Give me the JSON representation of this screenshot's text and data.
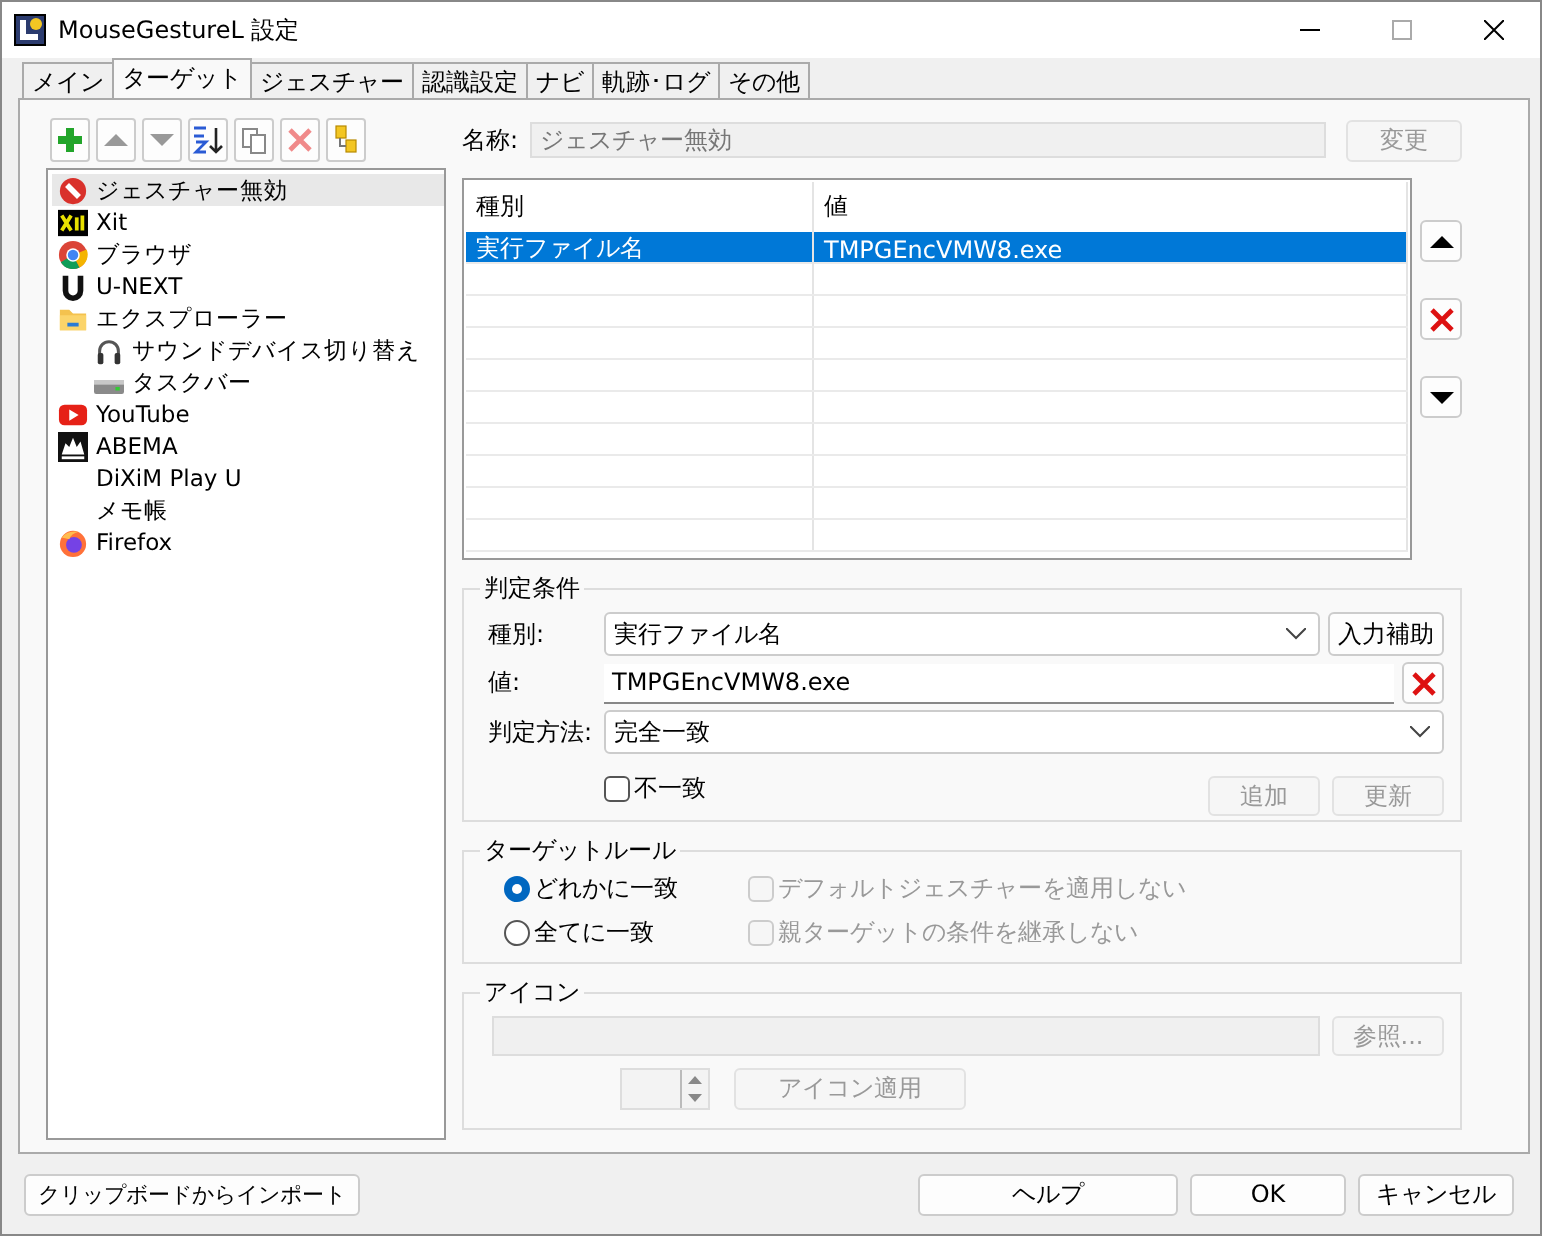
{
  "window": {
    "title": "MouseGestureL 設定"
  },
  "tabs": [
    {
      "label": "メイン",
      "selected": false
    },
    {
      "label": "ターゲット",
      "selected": true
    },
    {
      "label": "ジェスチャー",
      "selected": false
    },
    {
      "label": "認識設定",
      "selected": false
    },
    {
      "label": "ナビ",
      "selected": false
    },
    {
      "label": "軌跡･ログ",
      "selected": false
    },
    {
      "label": "その他",
      "selected": false
    }
  ],
  "targets": [
    {
      "label": "ジェスチャー無効",
      "selected": true
    },
    {
      "label": "Xit",
      "selected": false
    },
    {
      "label": "ブラウザ",
      "selected": false
    },
    {
      "label": "U-NEXT",
      "selected": false
    },
    {
      "label": "エクスプローラー",
      "selected": false,
      "children": [
        {
          "label": "サウンドデバイス切り替え",
          "selected": false
        },
        {
          "label": "タスクバー",
          "selected": false
        }
      ]
    },
    {
      "label": "YouTube",
      "selected": false
    },
    {
      "label": "ABEMA",
      "selected": false
    },
    {
      "label": "DiXiM Play U",
      "selected": false
    },
    {
      "label": "メモ帳",
      "selected": false
    },
    {
      "label": "Firefox",
      "selected": false
    }
  ],
  "name_field": {
    "label": "名称:",
    "value": "ジェスチャー無効",
    "disabled": true
  },
  "rename_button": {
    "label": "変更",
    "disabled": true
  },
  "conditions_table": {
    "columns": [
      "種別",
      "値"
    ],
    "rows": [
      {
        "cells": [
          "実行ファイル名",
          "TMPGEncVMW8.exe"
        ],
        "selected": true
      }
    ]
  },
  "criteria": {
    "title": "判定条件",
    "type_label": "種別:",
    "type_value": "実行ファイル名",
    "assist_button": "入力補助",
    "value_label": "値:",
    "value": "TMPGEncVMW8.exe",
    "method_label": "判定方法:",
    "method_value": "完全一致",
    "negate": {
      "label": "不一致",
      "checked": false
    },
    "buttons": [
      {
        "label": "追加",
        "disabled": true
      },
      {
        "label": "更新",
        "disabled": true
      }
    ]
  },
  "target_rule": {
    "title": "ターゲットルール",
    "radios": [
      {
        "label": "どれかに一致",
        "selected": true
      },
      {
        "label": "全てに一致",
        "selected": false
      }
    ],
    "options": [
      {
        "label": "デフォルトジェスチャーを適用しない",
        "checked": false,
        "disabled": true
      },
      {
        "label": "親ターゲットの条件を継承しない",
        "checked": false,
        "disabled": true
      }
    ]
  },
  "icon_group": {
    "title": "アイコン",
    "path_field": {
      "disabled": true
    },
    "browse_button": {
      "label": "参照...",
      "disabled": true
    },
    "apply_button": {
      "label": "アイコン適用",
      "disabled": true
    }
  },
  "footer_buttons": [
    {
      "label": "クリップボードからインポート"
    },
    {
      "label": "ヘルプ"
    },
    {
      "label": "OK"
    },
    {
      "label": "キャンセル"
    }
  ]
}
